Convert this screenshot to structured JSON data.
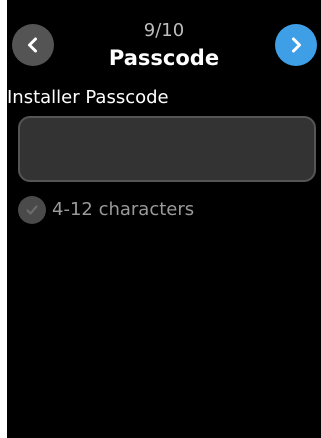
{
  "header": {
    "step": "9/10",
    "title": "Passcode",
    "back_icon": "chevron-left-icon",
    "next_icon": "chevron-right-icon",
    "back_color": "#545454",
    "next_color": "#3f9fe6"
  },
  "form": {
    "field_label": "Installer Passcode",
    "passcode_value": "",
    "requirement": {
      "text": "4-12 characters",
      "icon": "check-icon",
      "met": false
    }
  }
}
